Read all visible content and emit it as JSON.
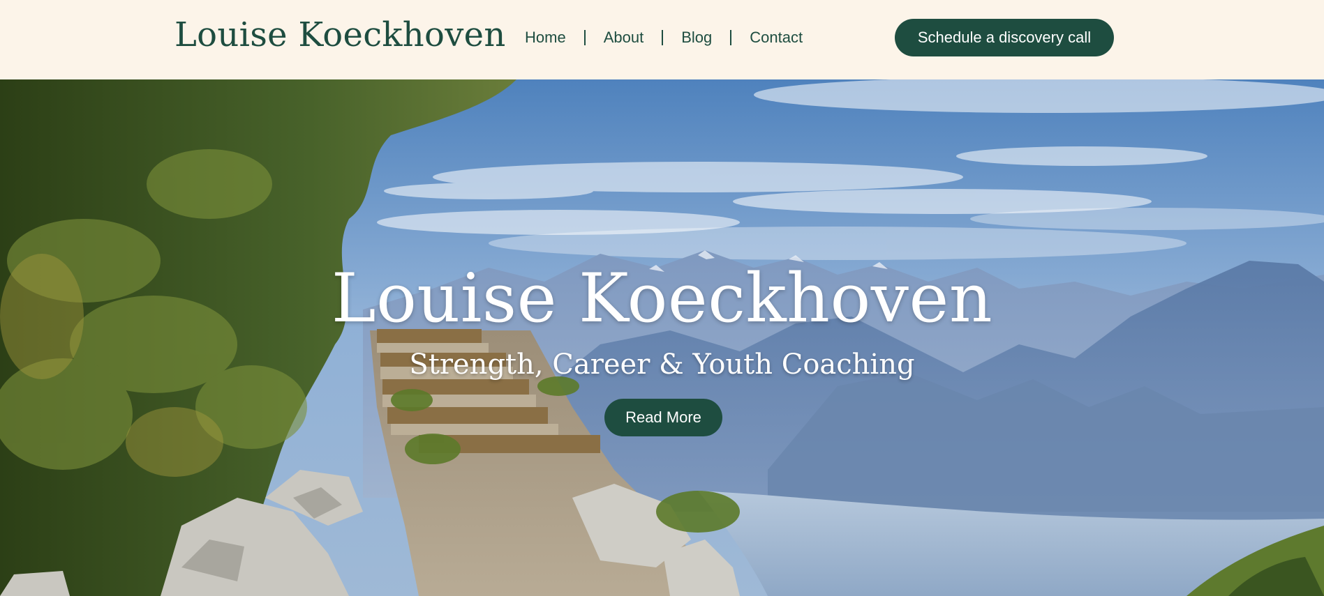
{
  "header": {
    "brand": "Louise Koeckhoven",
    "nav": [
      {
        "label": "Home"
      },
      {
        "label": "About"
      },
      {
        "label": "Blog"
      },
      {
        "label": "Contact"
      }
    ],
    "cta_label": "Schedule a discovery call"
  },
  "hero": {
    "title": "Louise Koeckhoven",
    "subtitle": "Strength, Career & Youth Coaching",
    "button_label": "Read More"
  },
  "colors": {
    "brand_green": "#1e4d40",
    "header_bg": "#fcf4e9",
    "hero_text": "#ffffff"
  }
}
